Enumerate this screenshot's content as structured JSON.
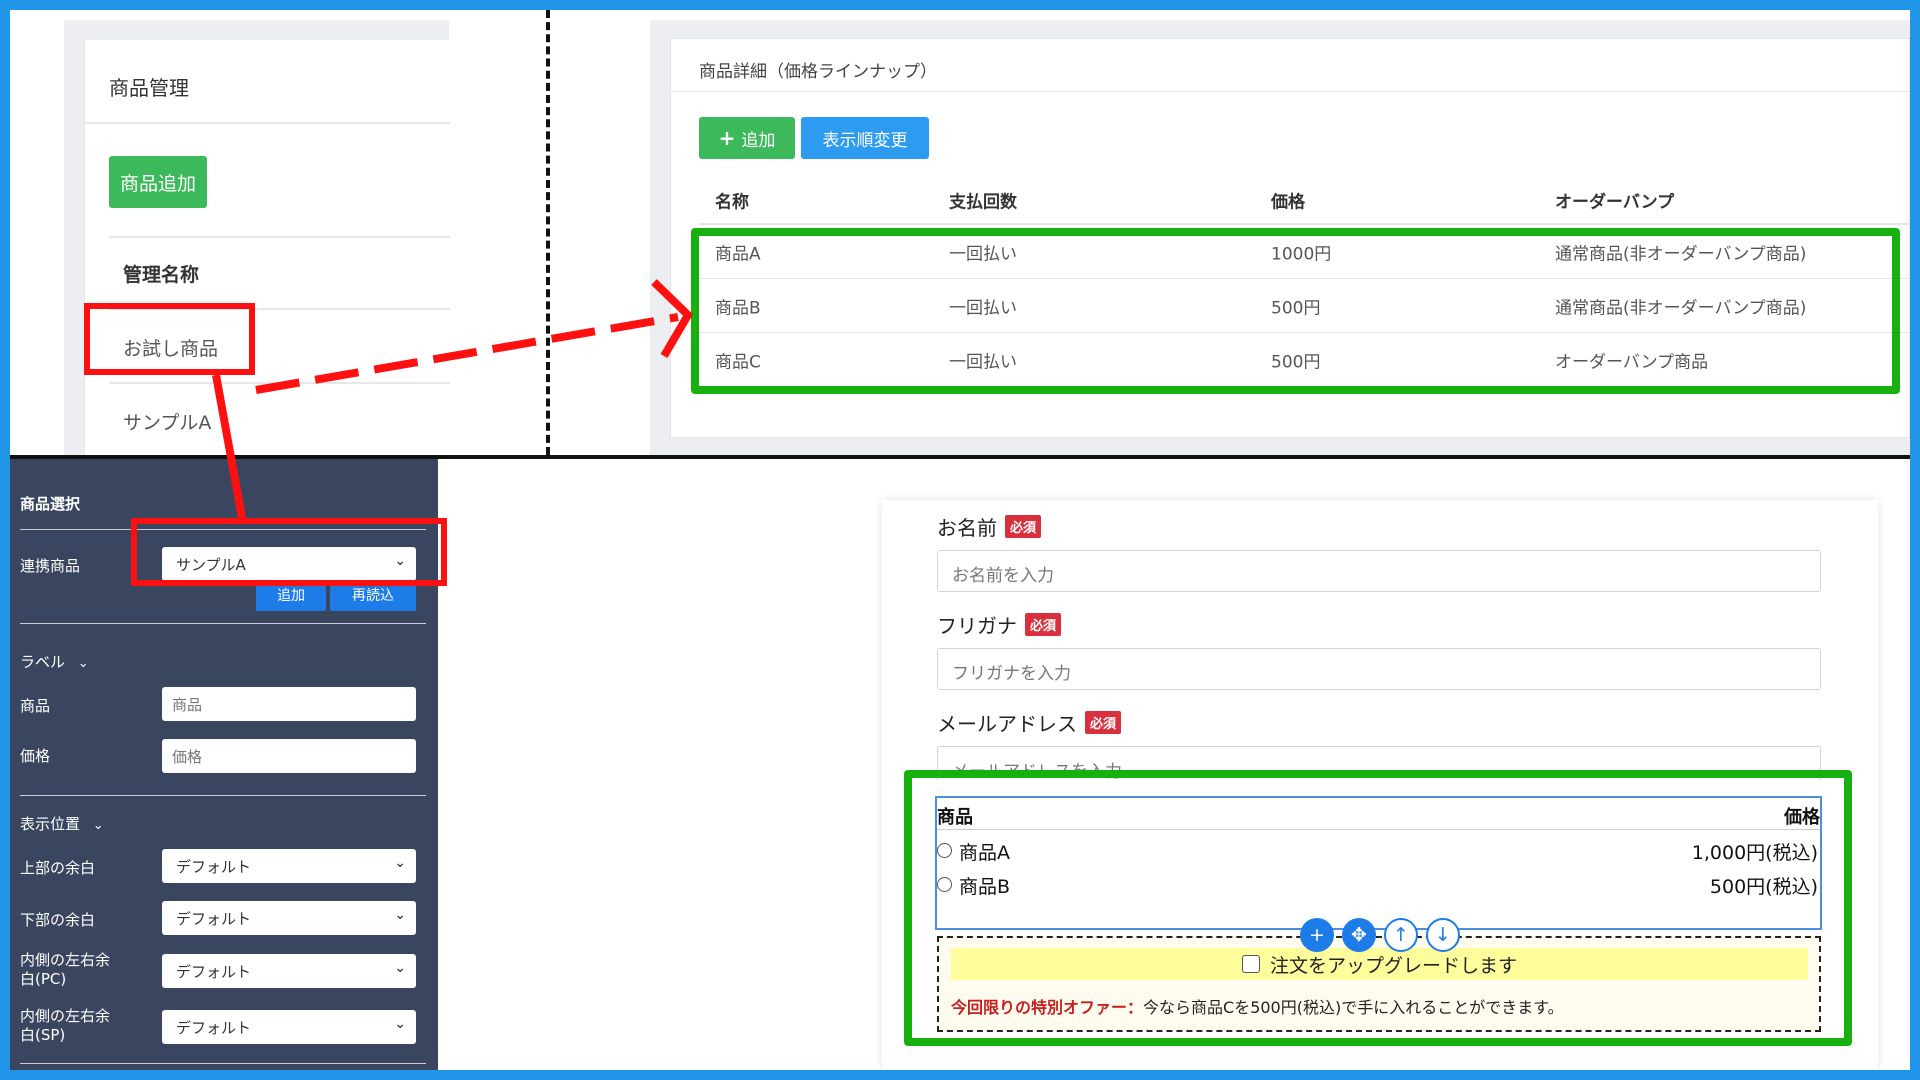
{
  "product_management": {
    "title": "商品管理",
    "add_button": "商品追加",
    "column_header": "管理名称",
    "rows": [
      "お試し商品",
      "サンプルA"
    ]
  },
  "product_detail": {
    "title": "商品詳細（価格ラインナップ）",
    "add_button": "追加",
    "reorder_button": "表示順変更",
    "headers": [
      "名称",
      "支払回数",
      "価格",
      "オーダーバンプ"
    ],
    "rows": [
      [
        "商品A",
        "一回払い",
        "1000円",
        "通常商品(非オーダーバンプ商品)"
      ],
      [
        "商品B",
        "一回払い",
        "500円",
        "通常商品(非オーダーバンプ商品)"
      ],
      [
        "商品C",
        "一回払い",
        "500円",
        "オーダーバンプ商品"
      ]
    ]
  },
  "sidebar": {
    "section_title": "商品選択",
    "linked_product_label": "連携商品",
    "linked_product_value": "サンプルA",
    "add_button": "追加",
    "reset_button": "再読込",
    "label_section": "ラベル",
    "product_label": "商品",
    "product_placeholder": "商品",
    "price_label": "価格",
    "price_placeholder": "価格",
    "position_section": "表示位置",
    "top_margin_label": "上部の余白",
    "top_margin_value": "デフォルト",
    "bottom_margin_label": "下部の余白",
    "bottom_margin_value": "デフォルト",
    "inner_pc_label": "内側の左右余白(PC)",
    "inner_pc_value": "デフォルト",
    "inner_sp_label": "内側の左右余白(SP)",
    "inner_sp_value": "デフォルト"
  },
  "form": {
    "name_label": "お名前",
    "name_placeholder": "お名前を入力",
    "kana_label": "フリガナ",
    "kana_placeholder": "フリガナを入力",
    "email_label": "メールアドレス",
    "email_placeholder": "メールアドレスを入力",
    "required_badge": "必須",
    "product_header": "商品",
    "price_header": "価格",
    "products": [
      {
        "name": "商品A",
        "price": "1,000円(税込)"
      },
      {
        "name": "商品B",
        "price": "500円(税込)"
      }
    ],
    "bump_checkbox": "注文をアップグレードします",
    "bump_offer_emphasis": "今回限りの特別オファー：",
    "bump_offer_text": "今なら商品Cを500円(税込)で手に入れることができます。"
  },
  "colors": {
    "annotation_red": "#ff1010",
    "annotation_green": "#16b10e",
    "sidebar_bg": "#3a4660",
    "success_green": "#3cb95a",
    "primary_blue": "#2d9bf0",
    "required_red": "#d9303e"
  }
}
